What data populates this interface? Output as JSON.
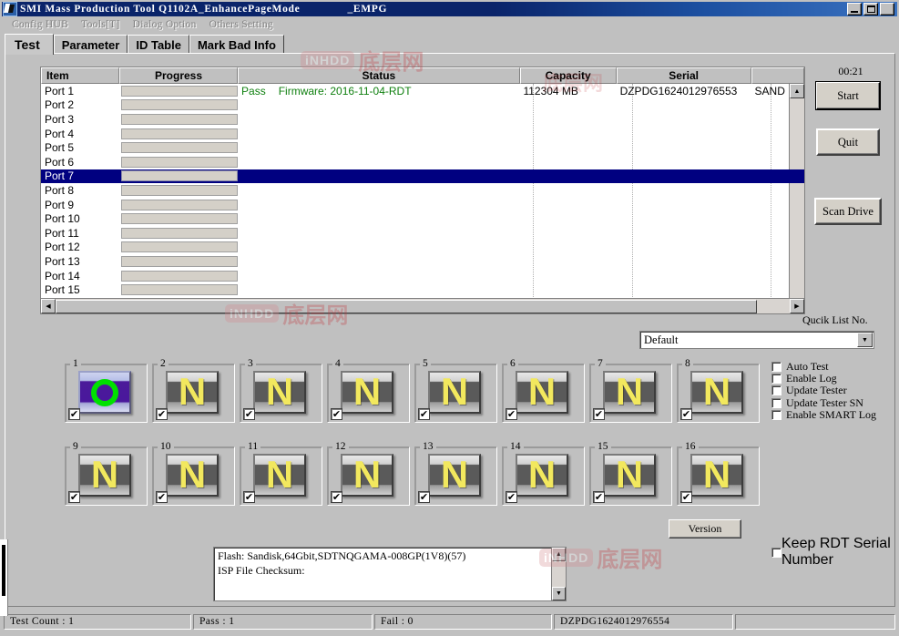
{
  "window": {
    "title": "SMI Mass Production Tool Q1102A_EnhancePageMode",
    "title_suffix": "_EMPG",
    "icon": "app-icon",
    "min_label": "Minimize",
    "max_label": "Maximize",
    "close_label": "Close"
  },
  "menubar": {
    "items": [
      {
        "label": "Config HUB"
      },
      {
        "label": "Tools[T]"
      },
      {
        "label": "Dialog Option"
      },
      {
        "label": "Others Setting"
      }
    ]
  },
  "tabs": [
    {
      "label": "Test",
      "active": true
    },
    {
      "label": "Parameter",
      "active": false
    },
    {
      "label": "ID Table",
      "active": false
    },
    {
      "label": "Mark Bad Info",
      "active": false
    }
  ],
  "list": {
    "columns": [
      {
        "label": "Item"
      },
      {
        "label": "Progress"
      },
      {
        "label": "Status"
      },
      {
        "label": "Capacity"
      },
      {
        "label": "Serial"
      },
      {
        "label": ""
      }
    ],
    "rows": [
      {
        "item": "Port 1",
        "status_pass": "Pass",
        "status_fw": "Firmware: 2016-11-04-RDT",
        "capacity": "112304 MB",
        "serial": "DZPDG1624012976553",
        "model": "SAND",
        "selected": false
      },
      {
        "item": "Port 2",
        "status_pass": "",
        "status_fw": "",
        "capacity": "",
        "serial": "",
        "model": "",
        "selected": false
      },
      {
        "item": "Port 3",
        "status_pass": "",
        "status_fw": "",
        "capacity": "",
        "serial": "",
        "model": "",
        "selected": false
      },
      {
        "item": "Port 4",
        "status_pass": "",
        "status_fw": "",
        "capacity": "",
        "serial": "",
        "model": "",
        "selected": false
      },
      {
        "item": "Port 5",
        "status_pass": "",
        "status_fw": "",
        "capacity": "",
        "serial": "",
        "model": "",
        "selected": false
      },
      {
        "item": "Port 6",
        "status_pass": "",
        "status_fw": "",
        "capacity": "",
        "serial": "",
        "model": "",
        "selected": false
      },
      {
        "item": "Port 7",
        "status_pass": "",
        "status_fw": "",
        "capacity": "",
        "serial": "",
        "model": "",
        "selected": true
      },
      {
        "item": "Port 8",
        "status_pass": "",
        "status_fw": "",
        "capacity": "",
        "serial": "",
        "model": "",
        "selected": false
      },
      {
        "item": "Port 9",
        "status_pass": "",
        "status_fw": "",
        "capacity": "",
        "serial": "",
        "model": "",
        "selected": false
      },
      {
        "item": "Port 10",
        "status_pass": "",
        "status_fw": "",
        "capacity": "",
        "serial": "",
        "model": "",
        "selected": false
      },
      {
        "item": "Port 11",
        "status_pass": "",
        "status_fw": "",
        "capacity": "",
        "serial": "",
        "model": "",
        "selected": false
      },
      {
        "item": "Port 12",
        "status_pass": "",
        "status_fw": "",
        "capacity": "",
        "serial": "",
        "model": "",
        "selected": false
      },
      {
        "item": "Port 13",
        "status_pass": "",
        "status_fw": "",
        "capacity": "",
        "serial": "",
        "model": "",
        "selected": false
      },
      {
        "item": "Port 14",
        "status_pass": "",
        "status_fw": "",
        "capacity": "",
        "serial": "",
        "model": "",
        "selected": false
      },
      {
        "item": "Port 15",
        "status_pass": "",
        "status_fw": "",
        "capacity": "",
        "serial": "",
        "model": "",
        "selected": false
      }
    ]
  },
  "sidebuttons": {
    "timer": "00:21",
    "start": "Start",
    "quit": "Quit",
    "scan": "Scan Drive"
  },
  "quicklist": {
    "label": "Qucik List No.",
    "selected": "Default",
    "options": [
      "Default"
    ]
  },
  "tiles": [
    {
      "num": "1",
      "glyph": "O",
      "checked": true,
      "active": true
    },
    {
      "num": "2",
      "glyph": "N",
      "checked": true,
      "active": false
    },
    {
      "num": "3",
      "glyph": "N",
      "checked": true,
      "active": false
    },
    {
      "num": "4",
      "glyph": "N",
      "checked": true,
      "active": false
    },
    {
      "num": "5",
      "glyph": "N",
      "checked": true,
      "active": false
    },
    {
      "num": "6",
      "glyph": "N",
      "checked": true,
      "active": false
    },
    {
      "num": "7",
      "glyph": "N",
      "checked": true,
      "active": false
    },
    {
      "num": "8",
      "glyph": "N",
      "checked": true,
      "active": false
    },
    {
      "num": "9",
      "glyph": "N",
      "checked": true,
      "active": false
    },
    {
      "num": "10",
      "glyph": "N",
      "checked": true,
      "active": false
    },
    {
      "num": "11",
      "glyph": "N",
      "checked": true,
      "active": false
    },
    {
      "num": "12",
      "glyph": "N",
      "checked": true,
      "active": false
    },
    {
      "num": "13",
      "glyph": "N",
      "checked": true,
      "active": false
    },
    {
      "num": "14",
      "glyph": "N",
      "checked": true,
      "active": false
    },
    {
      "num": "15",
      "glyph": "N",
      "checked": true,
      "active": false
    },
    {
      "num": "16",
      "glyph": "N",
      "checked": true,
      "active": false
    }
  ],
  "options": [
    {
      "label": "Auto Test",
      "checked": false
    },
    {
      "label": "Enable Log",
      "checked": false
    },
    {
      "label": "Update Tester",
      "checked": false
    },
    {
      "label": "Update Tester SN",
      "checked": false
    },
    {
      "label": "Enable SMART Log",
      "checked": false
    }
  ],
  "version_button": "Version",
  "keep_rdt": {
    "label": "Keep RDT Serial Number",
    "checked": false
  },
  "log": {
    "line1": "Flash: Sandisk,64Gbit,SDTNQGAMA-008GP(1V8)(57)",
    "line2": "ISP File Checksum:"
  },
  "statusbar": {
    "panes": [
      "Test Count : 1",
      "Pass : 1",
      "Fail : 0",
      "DZPDG1624012976554",
      ""
    ]
  },
  "watermark": {
    "en": "iNHDD",
    "cn": "底层网"
  },
  "colors": {
    "face": "#c0c0c0",
    "title_blue": "#0a246a",
    "selection": "#000080",
    "pass_green": "#108010",
    "glyph_yellow": "#f2e85e",
    "ring_green": "#00e000"
  }
}
